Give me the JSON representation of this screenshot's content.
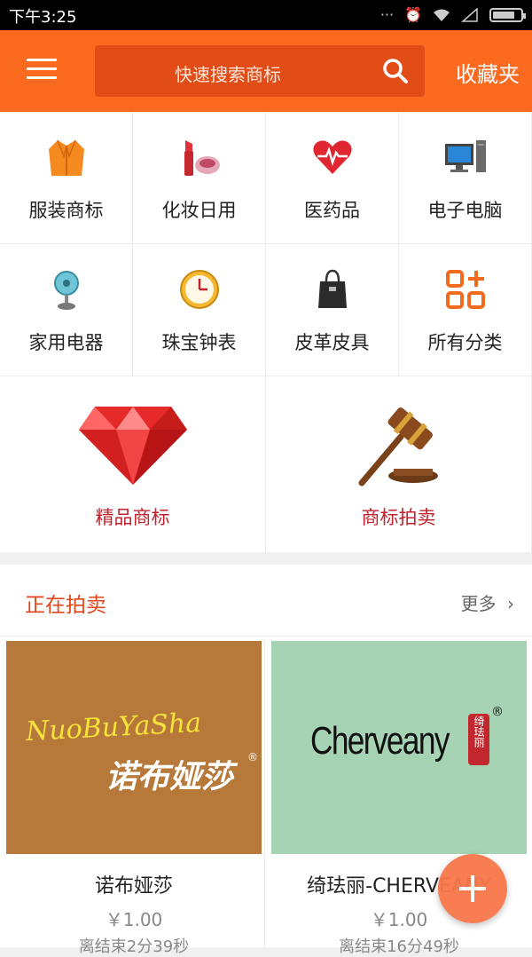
{
  "status_bar": {
    "time": "下午3:25"
  },
  "header": {
    "search_placeholder": "快速搜索商标",
    "favorites_label": "收藏夹"
  },
  "categories": [
    {
      "label": "服装商标",
      "icon": "coat-icon"
    },
    {
      "label": "化妆日用",
      "icon": "cosmetics-icon"
    },
    {
      "label": "医药品",
      "icon": "heart-pulse-icon"
    },
    {
      "label": "电子电脑",
      "icon": "computer-icon"
    },
    {
      "label": "家用电器",
      "icon": "fan-icon"
    },
    {
      "label": "珠宝钟表",
      "icon": "clock-icon"
    },
    {
      "label": "皮革皮具",
      "icon": "handbag-icon"
    },
    {
      "label": "所有分类",
      "icon": "grid-plus-icon"
    }
  ],
  "featured": [
    {
      "label": "精品商标",
      "icon": "diamond-icon"
    },
    {
      "label": "商标拍卖",
      "icon": "gavel-icon"
    }
  ],
  "auction": {
    "title": "正在拍卖",
    "more_label": "更多",
    "items": [
      {
        "name": "诺布娅莎",
        "logo_line1": "NuoBuYaSha",
        "logo_line2": "诺布娅莎",
        "price": "￥1.00",
        "remaining": "离结束2分39秒",
        "bg_color": "#b6793a"
      },
      {
        "name": "绮珐丽-CHERVEANY",
        "logo_line1": "Cherveany",
        "logo_line2": "绮珐丽",
        "price": "￥1.00",
        "remaining": "离结束16分49秒",
        "bg_color": "#a5d3b4"
      }
    ]
  },
  "colors": {
    "accent": "#fb6a1f",
    "search_bg": "#e14c17",
    "featured_text": "#c0212c",
    "section_title": "#e2451a"
  }
}
